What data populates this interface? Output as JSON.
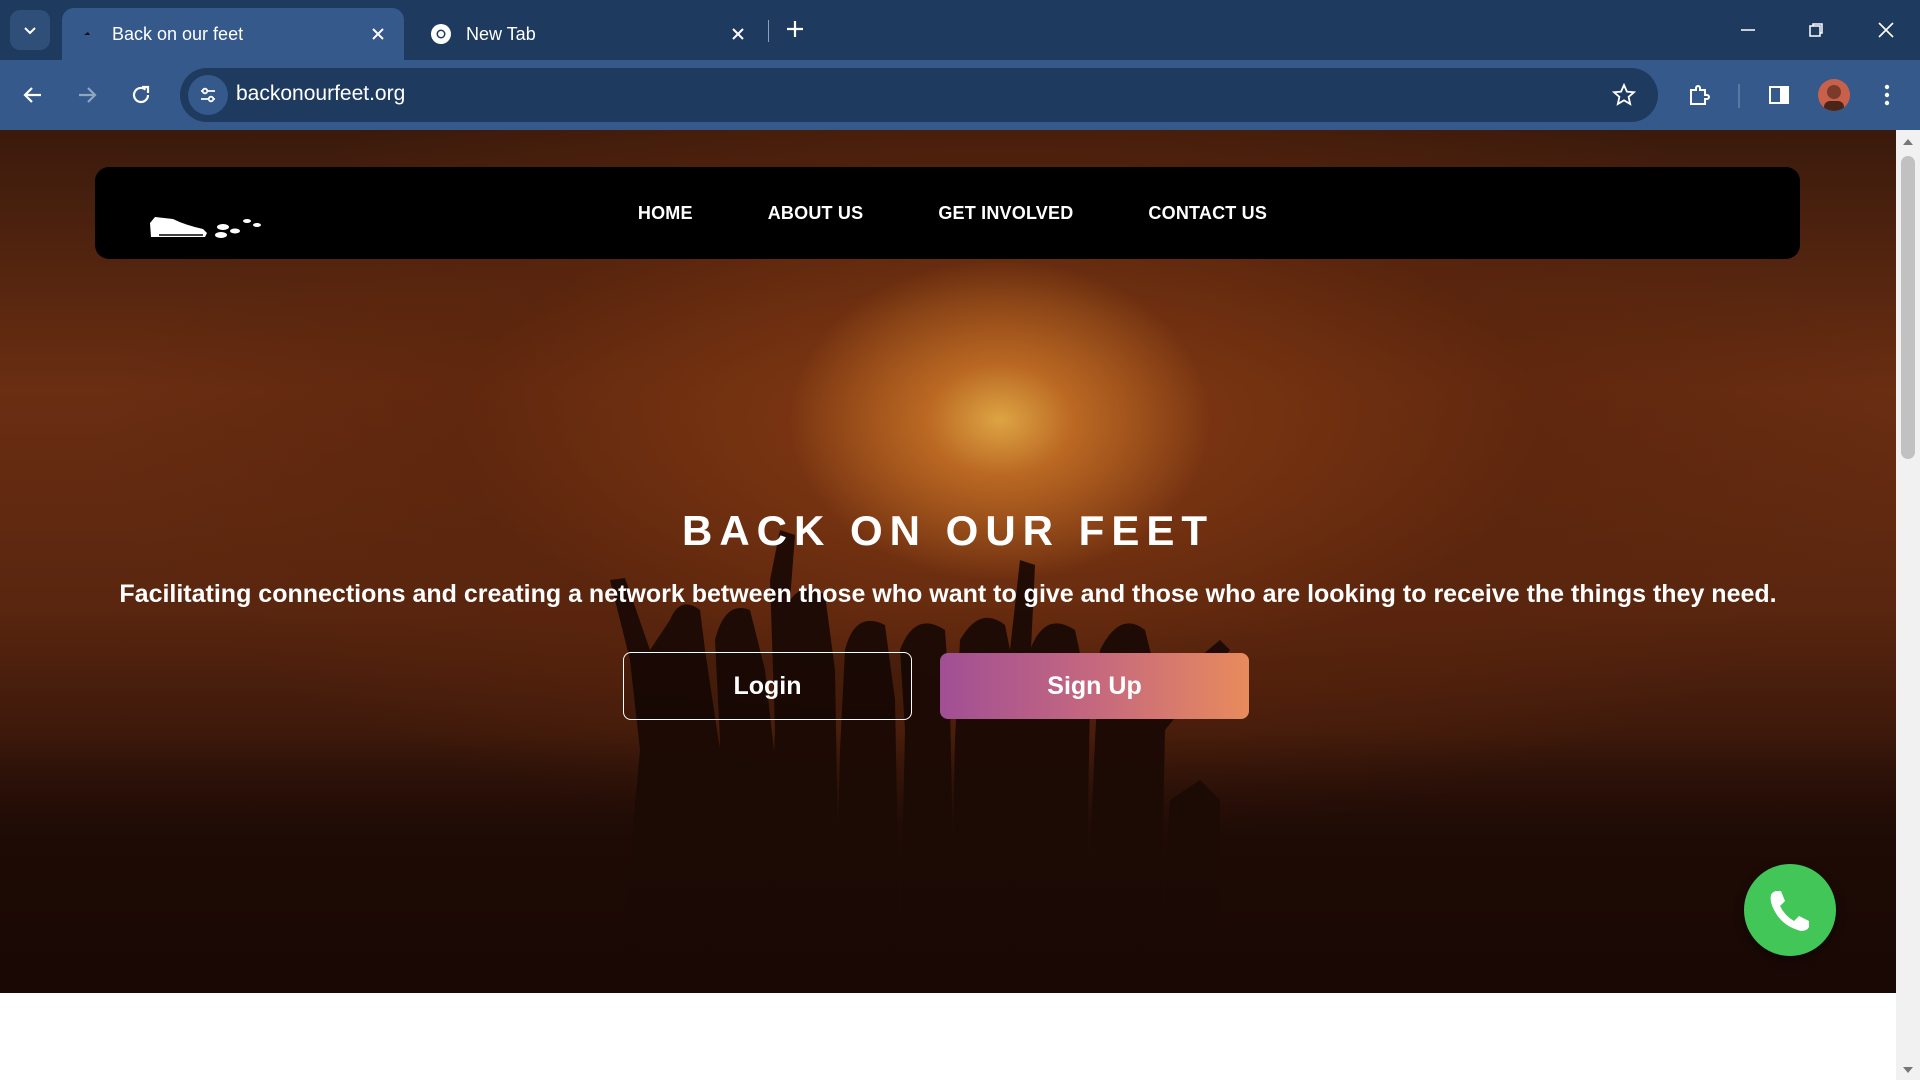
{
  "browser": {
    "tabs": [
      {
        "title": "Back on our feet",
        "active": true
      },
      {
        "title": "New Tab",
        "active": false
      }
    ],
    "url": "backonourfeet.org",
    "accent_color": "#35598a"
  },
  "site": {
    "nav": {
      "links": [
        "HOME",
        "ABOUT US",
        "GET INVOLVED",
        "CONTACT US"
      ]
    },
    "hero": {
      "title": "BACK ON OUR FEET",
      "subtitle": "Facilitating connections and creating a network between those who want to give and those who are looking to receive the things they need.",
      "login_label": "Login",
      "signup_label": "Sign Up"
    },
    "colors": {
      "whatsapp": "#43c658",
      "signup_gradient_start": "#a14f95",
      "signup_gradient_end": "#e88b5c"
    }
  }
}
